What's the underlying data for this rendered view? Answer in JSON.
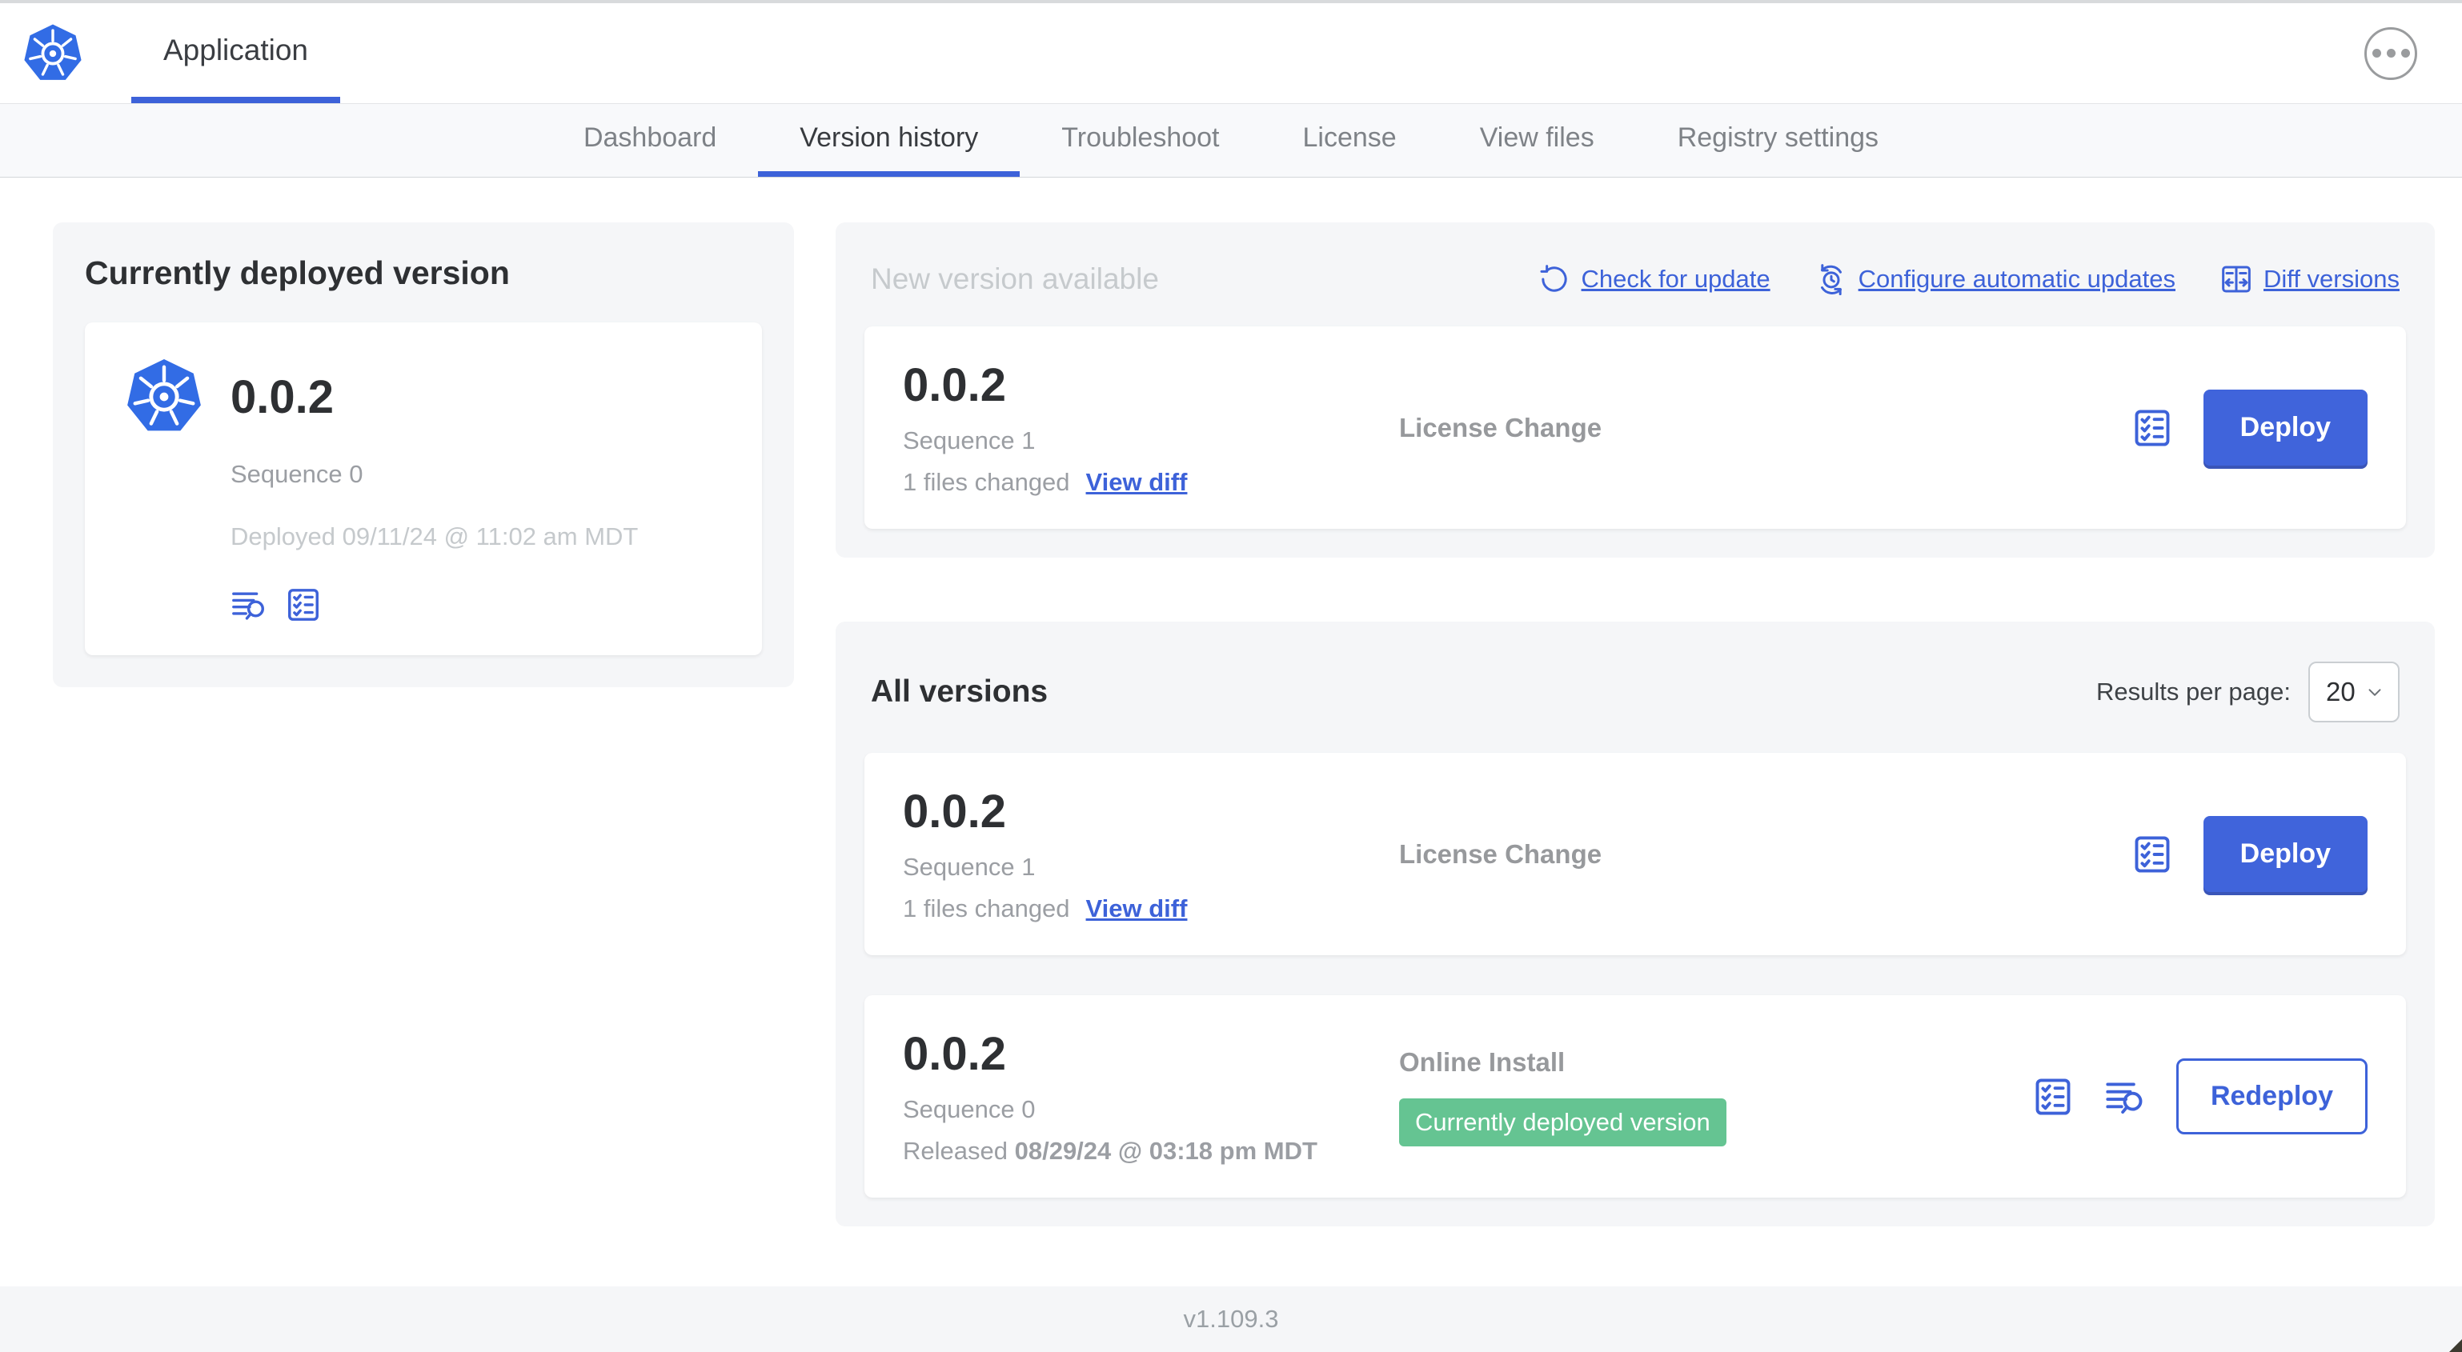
{
  "colors": {
    "accent": "#3d62d9",
    "button_blue": "#4064db",
    "logo_blue": "#326ce5",
    "badge_green": "#65c492",
    "section_background": "#f5f6f8"
  },
  "header": {
    "app_title": "Application"
  },
  "nav": {
    "tabs": [
      {
        "label": "Dashboard"
      },
      {
        "label": "Version history"
      },
      {
        "label": "Troubleshoot"
      },
      {
        "label": "License"
      },
      {
        "label": "View files"
      },
      {
        "label": "Registry settings"
      }
    ],
    "active_tab": "Version history"
  },
  "deployed_card": {
    "title": "Currently deployed version",
    "version": "0.0.2",
    "sequence": "Sequence 0",
    "deployed_at": "Deployed 09/11/24 @ 11:02 am MDT"
  },
  "new_version": {
    "title": "New version available",
    "check_link": "Check for update",
    "configure_link": "Configure automatic updates",
    "diff_link": "Diff versions",
    "card": {
      "version": "0.0.2",
      "sequence": "Sequence 1",
      "files_changed": "1 files changed",
      "view_diff": "View diff",
      "source": "License Change",
      "action": "Deploy"
    }
  },
  "all_versions": {
    "title": "All versions",
    "results_per_page_label": "Results per page:",
    "results_per_page_value": "20",
    "rows": [
      {
        "version": "0.0.2",
        "sequence": "Sequence 1",
        "files_changed": "1 files changed",
        "view_diff": "View diff",
        "source": "License Change",
        "action": "Deploy"
      },
      {
        "version": "0.0.2",
        "sequence": "Sequence 0",
        "released_prefix": "Released",
        "released_date": "08/29/24 @ 03:18 pm MDT",
        "source": "Online Install",
        "badge": "Currently deployed version",
        "action": "Redeploy"
      }
    ]
  },
  "footer": {
    "version": "v1.109.3"
  }
}
